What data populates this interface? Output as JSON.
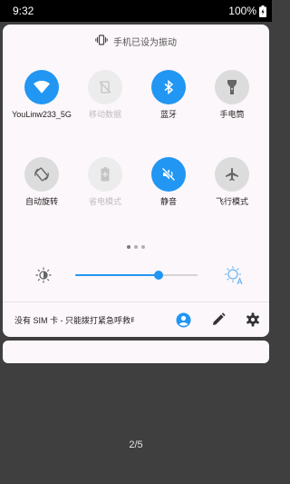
{
  "status_bar": {
    "time": "9:32",
    "battery": "100%"
  },
  "header": {
    "vibrate_text": "手机已设为振动",
    "icon": "vibrate-icon"
  },
  "tiles": [
    {
      "label": "YouLinw233_5G",
      "icon": "wifi-icon",
      "state": "on"
    },
    {
      "label": "移动数据",
      "icon": "mobile-data-off-icon",
      "state": "disabled"
    },
    {
      "label": "蓝牙",
      "icon": "bluetooth-icon",
      "state": "on"
    },
    {
      "label": "手电筒",
      "icon": "flashlight-icon",
      "state": "off"
    },
    {
      "label": "自动旋转",
      "icon": "auto-rotate-icon",
      "state": "off"
    },
    {
      "label": "省电模式",
      "icon": "battery-saver-icon",
      "state": "disabled"
    },
    {
      "label": "静音",
      "icon": "mute-icon",
      "state": "on"
    },
    {
      "label": "飞行模式",
      "icon": "airplane-icon",
      "state": "off"
    }
  ],
  "pager": {
    "dots": 3,
    "active": 1
  },
  "brightness": {
    "level": 0.68
  },
  "footer": {
    "carrier_text": "没有 SIM 卡 - 只能拨打紧急呼救电话",
    "icons": [
      "user-icon",
      "edit-icon",
      "settings-icon"
    ]
  },
  "page_indicator": "2/5",
  "colors": {
    "accent": "#2196f3",
    "panel": "#fcf7fa",
    "background": "#3f3f3f"
  }
}
